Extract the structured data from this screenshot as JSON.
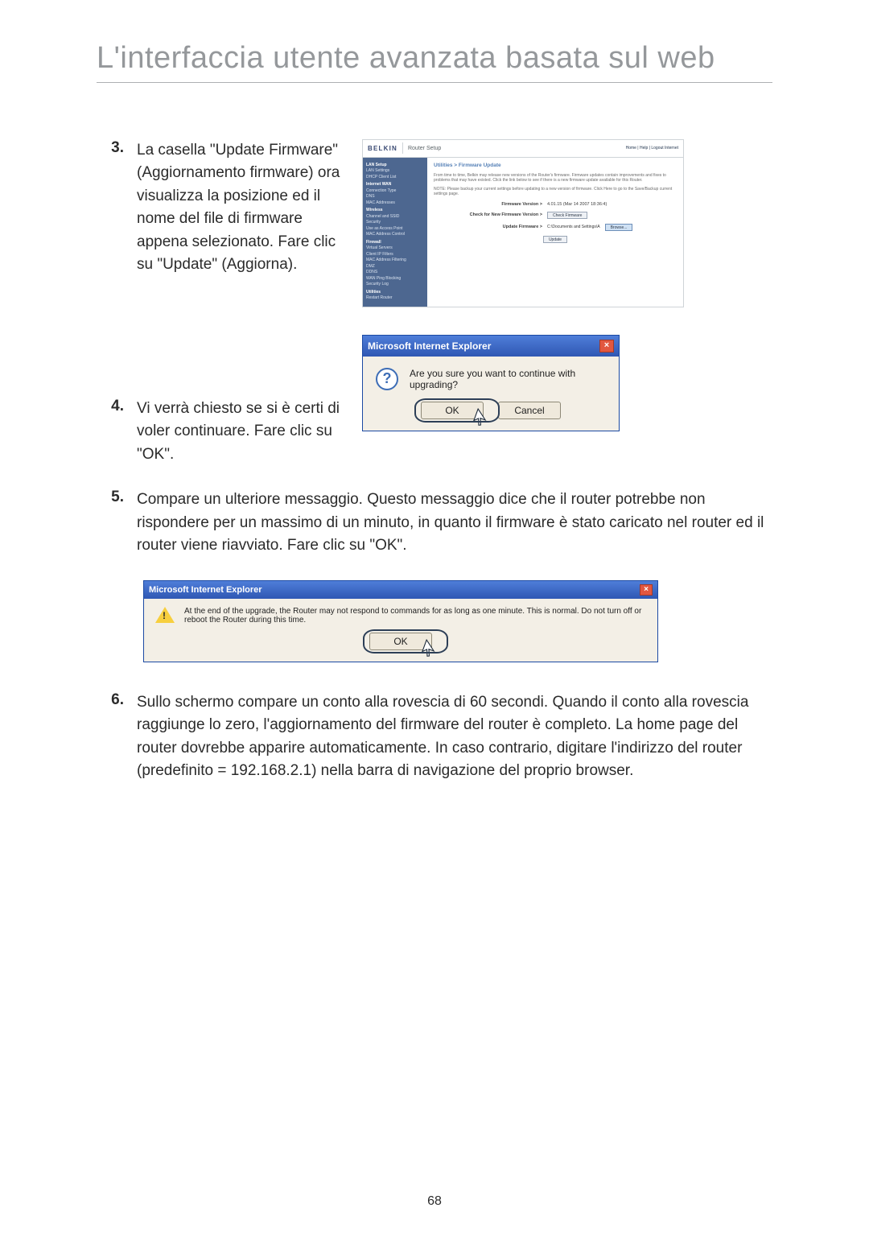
{
  "page": {
    "title": "L'interfaccia utente avanzata basata sul web",
    "number": "68"
  },
  "steps": {
    "s3": {
      "num": "3.",
      "text": "La casella \"Update Firmware\" (Aggiornamento firmware) ora visualizza la posizione ed il nome del file di firmware appena selezionato. Fare clic su \"Update\" (Aggiorna)."
    },
    "s4": {
      "num": "4.",
      "text": "Vi verrà chiesto se si è certi di voler continuare. Fare clic su \"OK\"."
    },
    "s5": {
      "num": "5.",
      "text": "Compare un ulteriore messaggio. Questo messaggio dice che il router potrebbe non rispondere per un massimo di un minuto, in quanto il firmware è stato caricato nel router ed il router viene riavviato. Fare clic su \"OK\"."
    },
    "s6": {
      "num": "6.",
      "text": "Sullo schermo compare un conto alla rovescia di 60 secondi. Quando il conto alla rovescia raggiunge lo zero, l'aggiornamento del firmware del router è completo. La home page del router dovrebbe apparire automaticamente. In caso contrario, digitare l'indirizzo del router (predefinito = 192.168.2.1) nella barra di navigazione del proprio browser."
    }
  },
  "router": {
    "brand": "BELKIN",
    "section": "Router Setup",
    "toplinks": "Home | Help | Logout   Internet",
    "crumb": "Utilities > Firmware Update",
    "para1": "From time to time, Belkin may release new versions of the Router's firmware. Firmware updates contain improvements and fixes to problems that may have existed. Click the link below to see if there is a new firmware update available for this Router.",
    "para2": "NOTE: Please backup your current settings before updating to a new version of firmware. Click Here to go to the Save/Backup current settings page.",
    "fv_label": "Firmware Version >",
    "fv_value": "4.01.15 (Mar 14 2007 18:36:4)",
    "chk_label": "Check for New Firmware Version >",
    "chk_btn": "Check Firmware",
    "upd_label": "Update Firmware >",
    "upd_path": "C:\\Documents and Settings\\A",
    "browse": "Browse...",
    "update_btn": "Update",
    "side": {
      "h1": "LAN Setup",
      "i1a": "LAN Settings",
      "i1b": "DHCP Client List",
      "h2": "Internet WAN",
      "i2a": "Connection Type",
      "i2b": "DNS",
      "i2c": "MAC Addresses",
      "h3": "Wireless",
      "i3a": "Channel and SSID",
      "i3b": "Security",
      "i3c": "Use as Access Point",
      "i3d": "MAC Address Control",
      "h4": "Firewall",
      "i4a": "Virtual Servers",
      "i4b": "Client IP Filters",
      "i4c": "MAC Address Filtering",
      "i4d": "DMZ",
      "i4e": "DDNS",
      "i4f": "WAN Ping Blocking",
      "i4g": "Security Log",
      "h5": "Utilities",
      "i5a": "Restart Router"
    }
  },
  "dlg1": {
    "title": "Microsoft Internet Explorer",
    "msg": "Are you sure you want to continue with upgrading?",
    "ok": "OK",
    "cancel": "Cancel"
  },
  "dlg2": {
    "title": "Microsoft Internet Explorer",
    "msg": "At the end of the upgrade, the Router may not respond to commands for as long as one minute. This is normal. Do not turn off or reboot the Router during this time.",
    "ok": "OK"
  }
}
